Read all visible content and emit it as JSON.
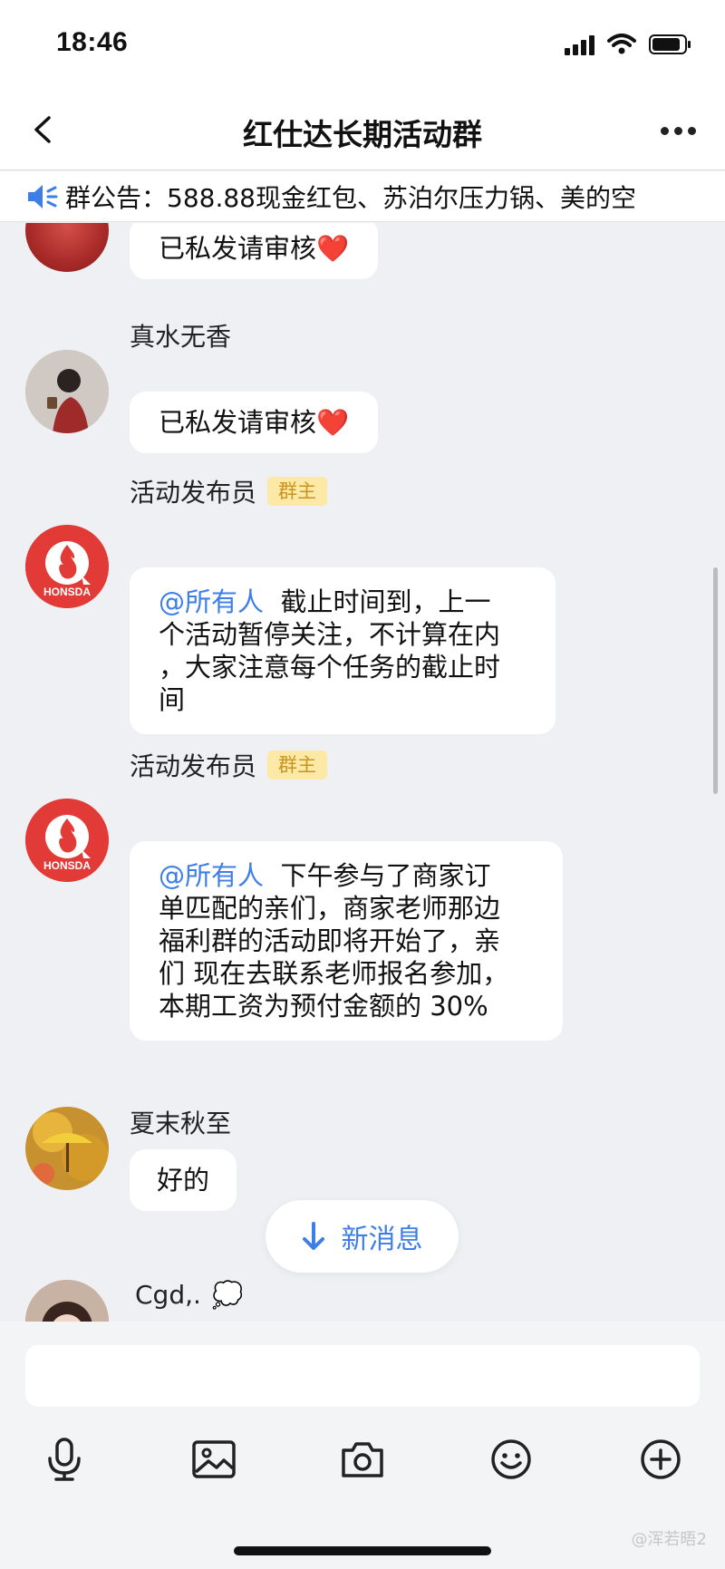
{
  "status_bar": {
    "time": "18:46"
  },
  "nav": {
    "title": "红仕达长期活动群"
  },
  "announcement": {
    "label": "群公告：",
    "text": "588.88现金红包、苏泊尔压力锅、美的空"
  },
  "messages": [
    {
      "sender": "",
      "text": "已私发请审核",
      "emoji": "❤️"
    },
    {
      "sender": "真水无香",
      "text": "已私发请审核",
      "emoji": "❤️"
    },
    {
      "sender": "活动发布员",
      "badge": "群主",
      "avatar_text": "HONSDA",
      "mention": "@所有人",
      "lines": [
        "截止时间到，上一",
        "个活动暂停关注，不计算在内",
        "，大家注意每个任务的截止时",
        "间"
      ]
    },
    {
      "sender": "活动发布员",
      "badge": "群主",
      "avatar_text": "HONSDA",
      "mention": "@所有人",
      "lines": [
        "下午参与了商家订",
        "单匹配的亲们，商家老师那边",
        "福利群的活动即将开始了，亲",
        "们 现在去联系老师报名参加，",
        "本期工资为预付金额的 30%"
      ]
    },
    {
      "sender": "夏末秋至",
      "text": "好的"
    },
    {
      "sender": "Cgd,.",
      "emoji": "💭"
    }
  ],
  "new_message_button": {
    "label": "新消息"
  },
  "input": {
    "placeholder": ""
  },
  "toolbar": {
    "icons": [
      "microphone-icon",
      "image-icon",
      "camera-icon",
      "emoji-icon",
      "plus-icon"
    ]
  },
  "watermark": {
    "text": "@浑若晤2"
  },
  "colors": {
    "accent": "#3d7ee8",
    "badge_bg": "#fde9a6",
    "badge_text": "#c9941e",
    "brand_red": "#e23a36"
  }
}
